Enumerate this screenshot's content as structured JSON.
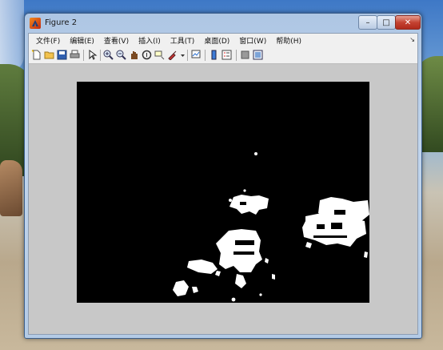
{
  "window": {
    "title": "Figure 2"
  },
  "titlebar": {
    "minimize": "–",
    "maximize": "□",
    "close": "✕"
  },
  "menu": [
    {
      "label": "文件(F)"
    },
    {
      "label": "编辑(E)"
    },
    {
      "label": "查看(V)"
    },
    {
      "label": "插入(I)"
    },
    {
      "label": "工具(T)"
    },
    {
      "label": "桌面(D)"
    },
    {
      "label": "窗口(W)"
    },
    {
      "label": "帮助(H)"
    }
  ],
  "menu_overflow": "↘",
  "toolbar": [
    "new-figure-icon",
    "open-file-icon",
    "save-icon",
    "print-icon",
    "pointer-icon",
    "zoom-in-icon",
    "zoom-out-icon",
    "pan-icon",
    "rotate-3d-icon",
    "data-cursor-icon",
    "brush-icon",
    "link-plot-icon",
    "colorbar-icon",
    "legend-icon",
    "hide-plot-tools-icon",
    "show-plot-tools-icon"
  ],
  "figure": {
    "image": "binary-mask-black-background-white-blobs"
  }
}
